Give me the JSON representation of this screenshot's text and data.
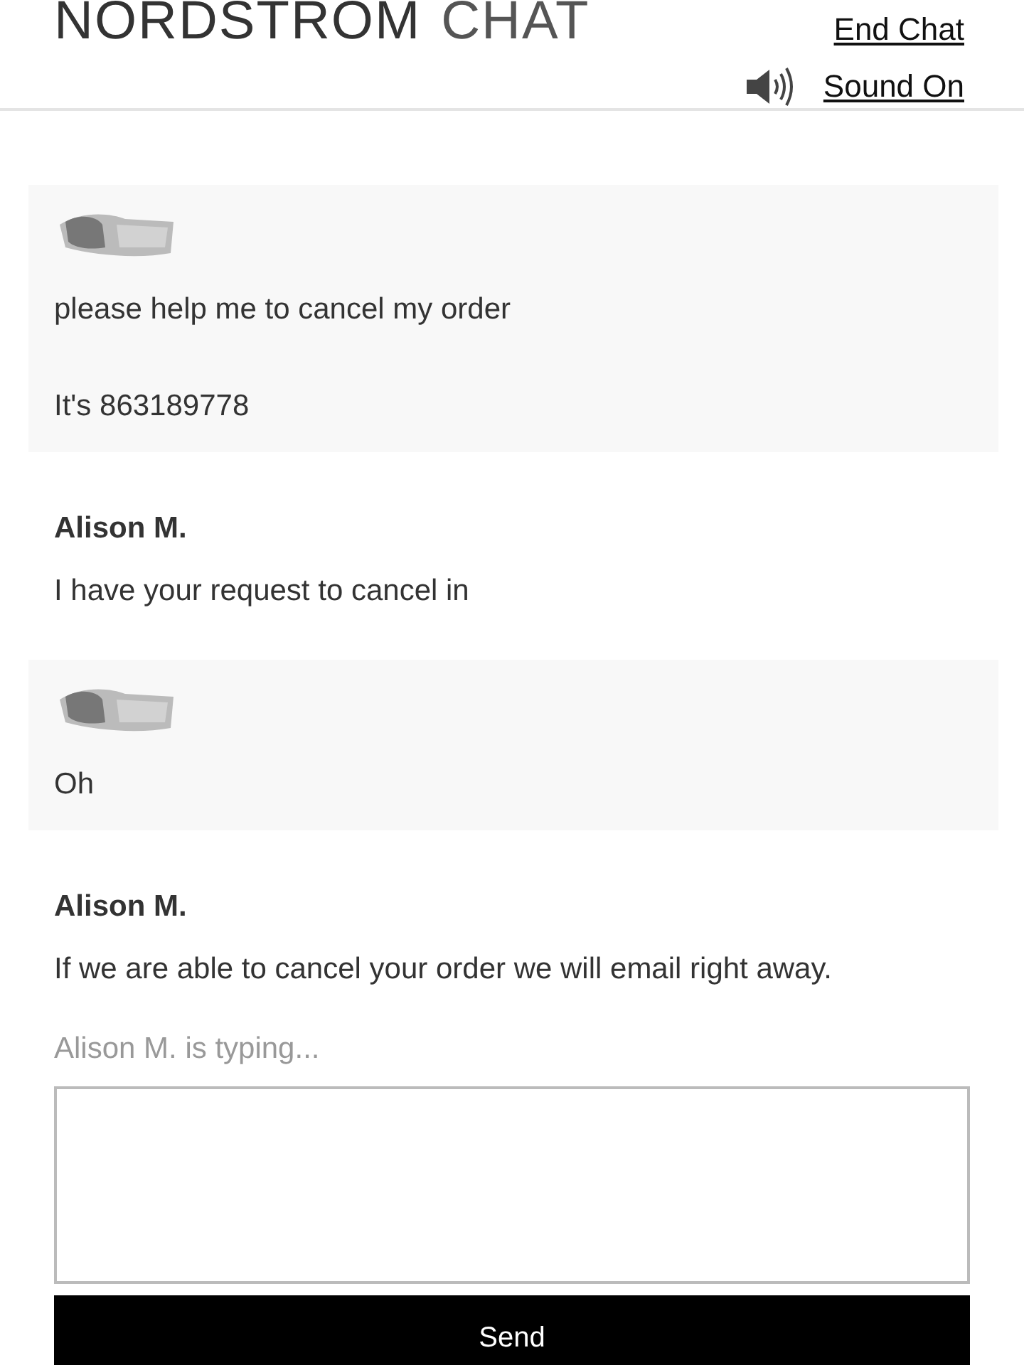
{
  "header": {
    "brand": "NORDSTROM",
    "title": "CHAT",
    "end_chat": "End Chat",
    "sound": {
      "label": "Sound On"
    }
  },
  "messages": [
    {
      "kind": "customer",
      "paragraphs": [
        "please help me to cancel my order",
        "It's 863189778"
      ]
    },
    {
      "kind": "agent",
      "author": "Alison M.",
      "paragraphs": [
        "I have your request to cancel in"
      ]
    },
    {
      "kind": "customer",
      "paragraphs": [
        "Oh"
      ]
    },
    {
      "kind": "agent",
      "author": "Alison M.",
      "paragraphs": [
        "If we are able to cancel your order we will email right away."
      ]
    }
  ],
  "typing_status": "Alison M. is typing...",
  "send_button": "Send"
}
